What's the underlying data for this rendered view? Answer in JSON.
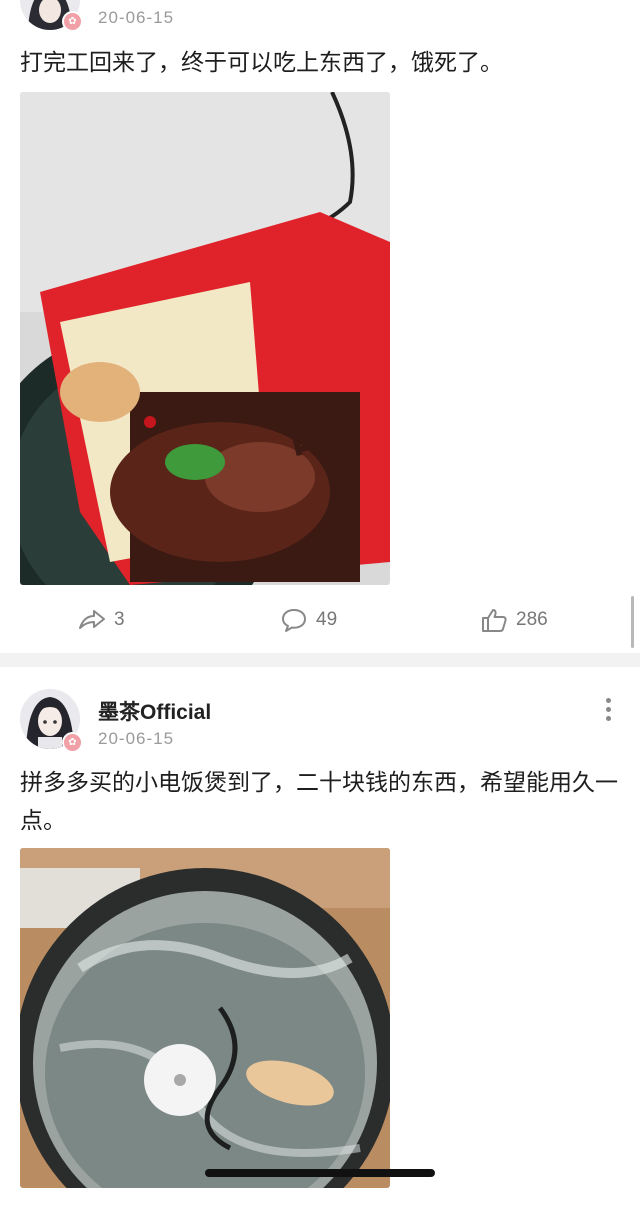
{
  "posts": [
    {
      "date": "20-06-15",
      "text": "打完工回来了，终于可以吃上东西了，饿死了。",
      "stats": {
        "shares": "3",
        "comments": "49",
        "likes": "286"
      }
    },
    {
      "author": "墨茶Official",
      "date": "20-06-15",
      "text": "拼多多买的小电饭煲到了，二十块钱的东西，希望能用久一点。"
    }
  ],
  "colors": {
    "accent_badge": "#f0a0a6",
    "noodle_red": "#e0232a",
    "muted": "#9a9a9a"
  }
}
